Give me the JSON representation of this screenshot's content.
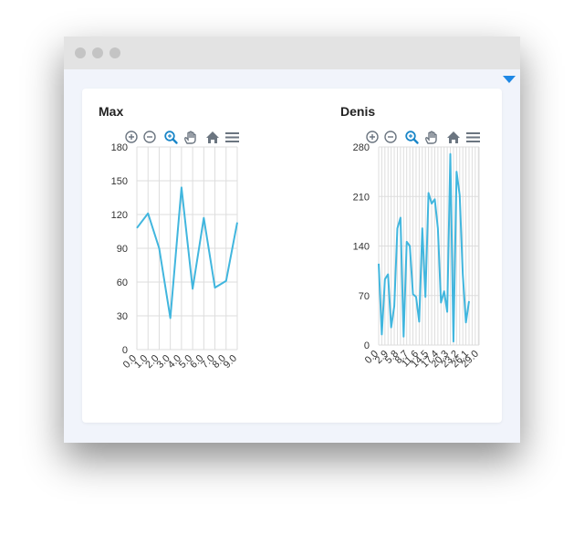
{
  "colors": {
    "line": "#41b6de",
    "grid": "#dddddd",
    "accent": "#1e88e5",
    "tool": "#6b7580",
    "tool_active": "#1a86c8"
  },
  "toolbar": {
    "icons": [
      "zoom-in-icon",
      "zoom-out-icon",
      "zoom-selection-icon",
      "pan-hand-icon",
      "home-reset-icon",
      "menu-icon"
    ],
    "active": "zoom-selection-icon"
  },
  "charts": [
    {
      "title": "Max"
    },
    {
      "title": "Denis"
    }
  ],
  "chart_data": [
    {
      "type": "line",
      "title": "Max",
      "x": [
        0.0,
        1.0,
        2.0,
        3.0,
        4.0,
        5.0,
        6.0,
        7.0,
        8.0,
        9.0
      ],
      "xticks": [
        "0.0",
        "1.0",
        "2.0",
        "3.0",
        "4.0",
        "5.0",
        "6.0",
        "7.0",
        "8.0",
        "9.0"
      ],
      "series": [
        {
          "values": [
            108,
            121,
            90,
            28,
            144,
            54,
            117,
            55,
            61,
            113
          ]
        }
      ],
      "ylim": [
        0,
        180
      ],
      "yticks": [
        0,
        30,
        60,
        90,
        120,
        150,
        180
      ],
      "grid": true
    },
    {
      "type": "line",
      "title": "Denis",
      "x": [
        0.0,
        0.9,
        1.8,
        2.7,
        3.6,
        4.5,
        5.4,
        6.3,
        7.2,
        8.1,
        9.0,
        9.9,
        10.8,
        11.7,
        12.6,
        13.5,
        14.4,
        15.3,
        16.2,
        17.1,
        18.0,
        18.9,
        19.8,
        20.7,
        21.6,
        22.5,
        23.4,
        24.3,
        25.2,
        26.1,
        27.0,
        27.9,
        28.8,
        29.0
      ],
      "xticks": [
        "0.0",
        "2.9",
        "5.8",
        "8.7",
        "11.6",
        "14.5",
        "17.4",
        "20.3",
        "23.2",
        "26.1",
        "29.0"
      ],
      "series": [
        {
          "values": [
            115,
            15,
            93,
            100,
            25,
            55,
            165,
            180,
            12,
            146,
            140,
            72,
            68,
            33,
            165,
            68,
            215,
            200,
            206,
            165,
            60,
            76,
            47,
            270,
            5,
            245,
            212,
            100,
            32,
            62
          ]
        }
      ],
      "ylim": [
        0,
        280
      ],
      "yticks": [
        0,
        70,
        140,
        210,
        280
      ],
      "grid": true
    }
  ]
}
